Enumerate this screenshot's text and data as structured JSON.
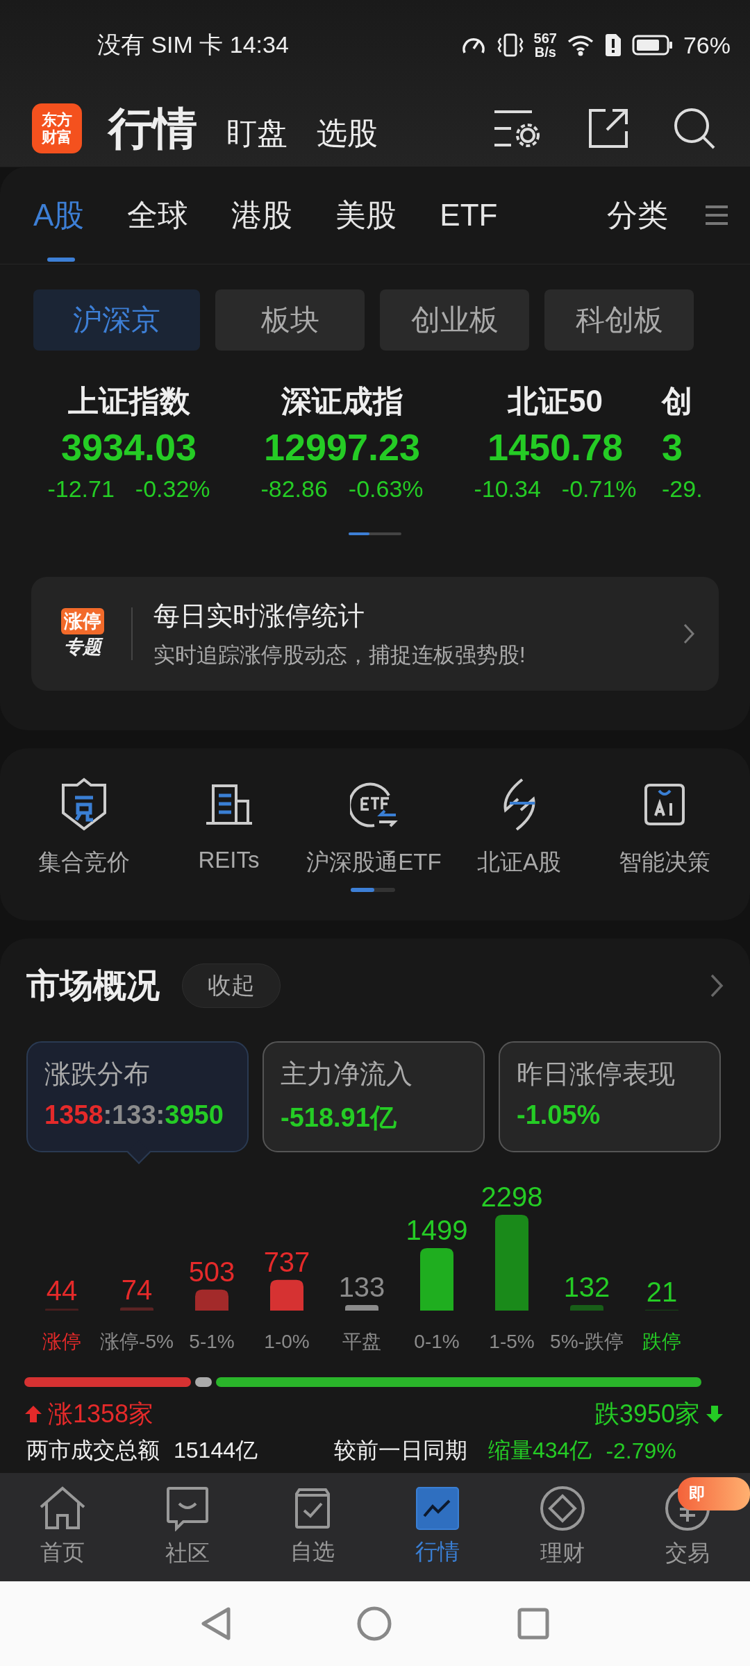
{
  "status_bar": {
    "carrier_time": "没有 SIM 卡 14:34",
    "speed_value": "567",
    "speed_unit": "B/s",
    "battery": "76%"
  },
  "header": {
    "logo_lines": [
      "东方",
      "财富"
    ],
    "tabs": [
      {
        "label": "行情",
        "selected": true
      },
      {
        "label": "盯盘",
        "selected": false
      },
      {
        "label": "选股",
        "selected": false
      }
    ]
  },
  "market_tabs": [
    {
      "label": "A股",
      "selected": true
    },
    {
      "label": "全球",
      "selected": false
    },
    {
      "label": "港股",
      "selected": false
    },
    {
      "label": "美股",
      "selected": false
    },
    {
      "label": "ETF",
      "selected": false
    }
  ],
  "category_button": "分类",
  "sub_tabs": [
    {
      "label": "沪深京",
      "selected": true
    },
    {
      "label": "板块",
      "selected": false
    },
    {
      "label": "创业板",
      "selected": false
    },
    {
      "label": "科创板",
      "selected": false
    }
  ],
  "indices": [
    {
      "name": "上证指数",
      "value": "3934.03",
      "change": "-12.71",
      "percent": "-0.32%",
      "color": "#25cc25"
    },
    {
      "name": "深证成指",
      "value": "12997.23",
      "change": "-82.86",
      "percent": "-0.63%",
      "color": "#25cc25"
    },
    {
      "name": "北证50",
      "value": "1450.78",
      "change": "-10.34",
      "percent": "-0.71%",
      "color": "#25cc25"
    },
    {
      "name": "创",
      "value": "3",
      "change": "-29.",
      "color": "#25cc25"
    }
  ],
  "banner": {
    "badge_lines": [
      "涨停",
      "专题"
    ],
    "title": "每日实时涨停统计",
    "subtitle": "实时追踪涨停股动态，捕捉连板强势股!"
  },
  "shortcuts": [
    {
      "label": "集合竞价"
    },
    {
      "label": "REITs"
    },
    {
      "label": "沪深股通ETF"
    },
    {
      "label": "北证A股"
    },
    {
      "label": "智能决策"
    }
  ],
  "market_overview": {
    "title": "市场概况",
    "collapse_button": "收起",
    "cards": [
      {
        "label": "涨跌分布",
        "selected": true,
        "parts": [
          {
            "text": "1358",
            "color": "#e52a2a"
          },
          {
            "text": ":133:",
            "color": "#8c8c8c"
          },
          {
            "text": "3950",
            "color": "#25cc25"
          }
        ]
      },
      {
        "label": "主力净流入",
        "selected": false,
        "parts": [
          {
            "text": "-518.91亿",
            "color": "#25cc25"
          }
        ]
      },
      {
        "label": "昨日涨停表现",
        "selected": false,
        "parts": [
          {
            "text": "-1.05%",
            "color": "#25cc25"
          }
        ]
      }
    ],
    "chart_data": {
      "type": "bar",
      "categories": [
        "涨停",
        "涨停-5%",
        "5-1%",
        "1-0%",
        "平盘",
        "0-1%",
        "1-5%",
        "5%-跌停",
        "跌停"
      ],
      "series": [
        {
          "values": [
            44,
            74,
            503,
            737,
            133,
            1499,
            2298,
            132,
            21
          ],
          "colors": [
            "#4a1f1f",
            "#5c2424",
            "#a32a2a",
            "#d63232",
            "#8c8c8c",
            "#1fae1f",
            "#1a8a1a",
            "#185e18",
            "#183f18"
          ]
        }
      ],
      "data_labels": true
    },
    "value_labels": [
      {
        "color": "#e52a2a"
      },
      {
        "color": "#e52a2a"
      },
      {
        "color": "#e52a2a"
      },
      {
        "color": "#e52a2a"
      },
      {
        "color": "#8c8c8c"
      },
      {
        "color": "#25cc25"
      },
      {
        "color": "#25cc25"
      },
      {
        "color": "#25cc25"
      },
      {
        "color": "#25cc25"
      }
    ],
    "category_labels": [
      {
        "color": "#e52a2a"
      },
      {
        "color": "#8c8c8c"
      },
      {
        "color": "#8c8c8c"
      },
      {
        "color": "#8c8c8c"
      },
      {
        "color": "#8c8c8c"
      },
      {
        "color": "#8c8c8c"
      },
      {
        "color": "#8c8c8c"
      },
      {
        "color": "#8c8c8c"
      },
      {
        "color": "#25cc25"
      }
    ],
    "up_summary": "涨1358家",
    "down_summary": "跌3950家",
    "turnover_label": "两市成交总额",
    "turnover_value": "15144亿",
    "compare_label": "较前一日同期",
    "compare_change": "缩量434亿",
    "compare_percent": "-2.79%"
  },
  "bottom_nav": [
    {
      "label": "首页",
      "selected": false
    },
    {
      "label": "社区",
      "selected": false
    },
    {
      "label": "自选",
      "selected": false
    },
    {
      "label": "行情",
      "selected": true
    },
    {
      "label": "理财",
      "selected": false
    },
    {
      "label": "交易",
      "selected": false,
      "badge": "即"
    }
  ]
}
